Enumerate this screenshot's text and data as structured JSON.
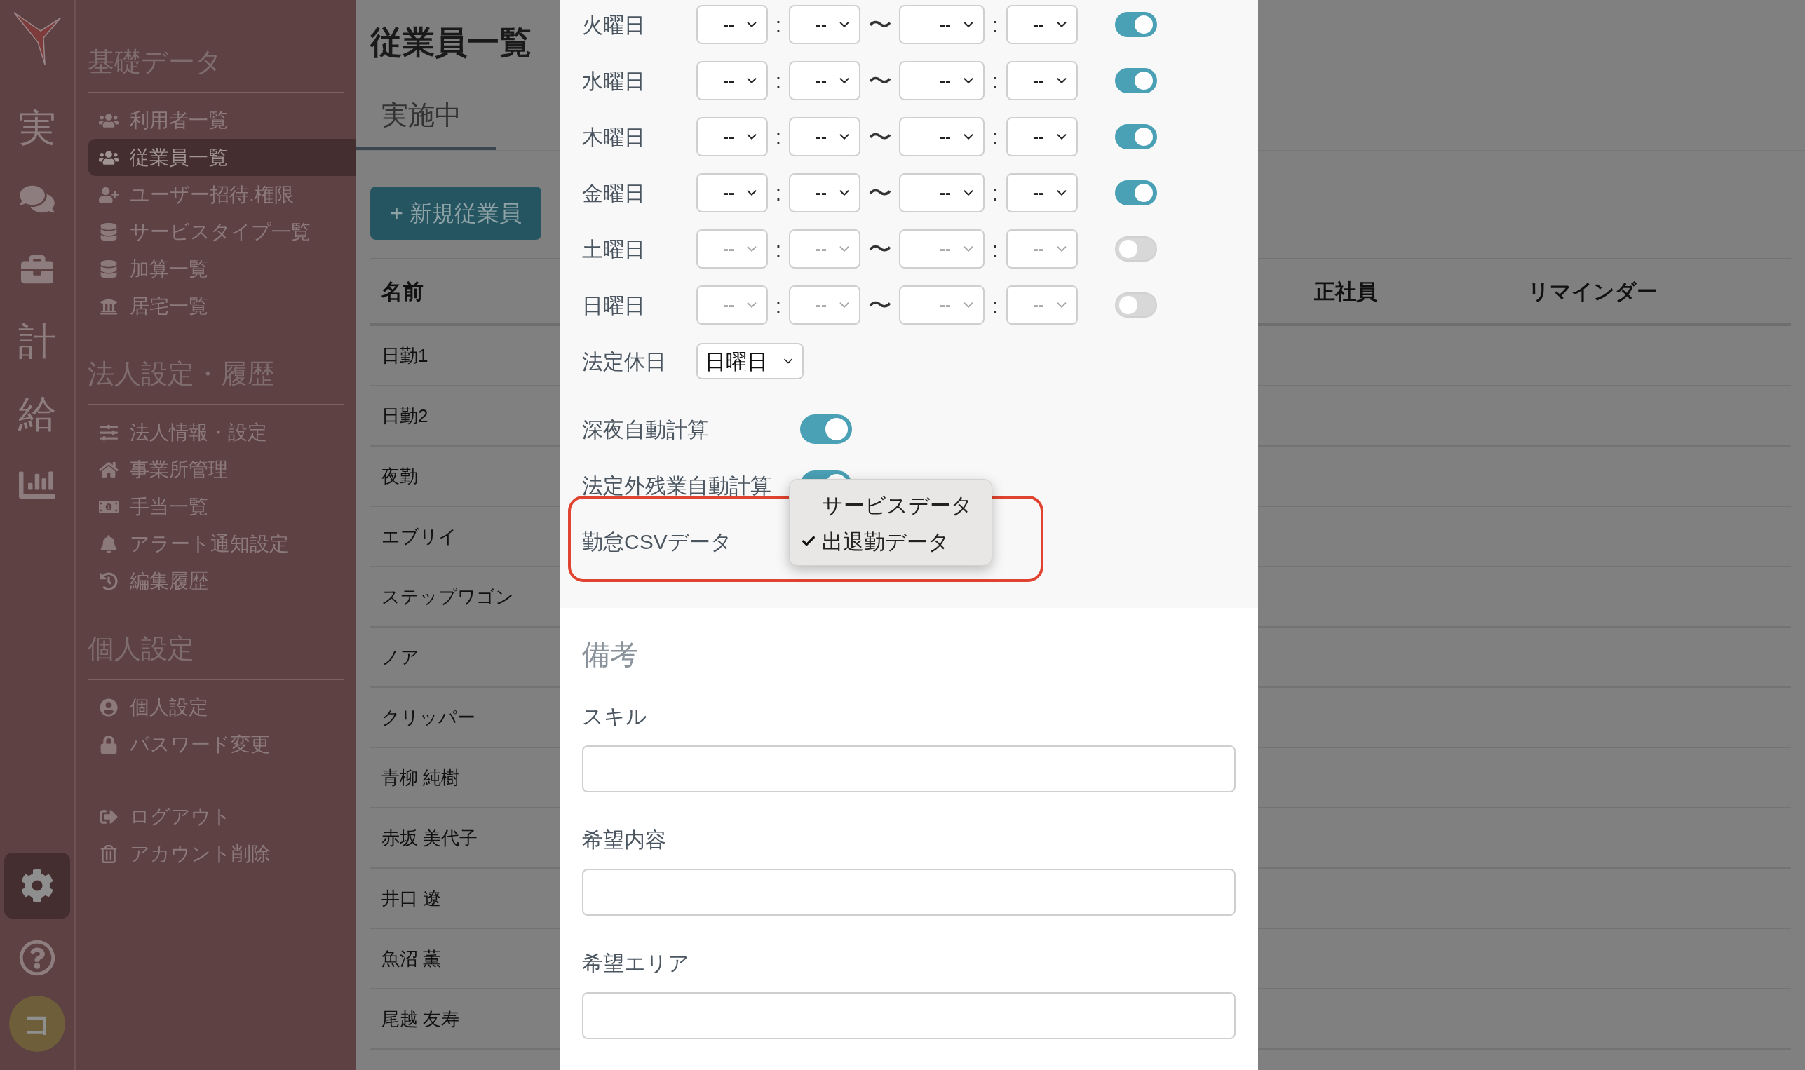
{
  "rail": {
    "items": [
      {
        "kind": "text",
        "label": "実"
      },
      {
        "kind": "chat"
      },
      {
        "kind": "briefcase"
      },
      {
        "kind": "text",
        "label": "計"
      },
      {
        "kind": "text",
        "label": "給"
      },
      {
        "kind": "chart"
      }
    ],
    "settings_selected": true,
    "avatar": "コ"
  },
  "sidebar": {
    "sections": [
      {
        "title": "基礎データ",
        "items": [
          {
            "kind": "users",
            "label": "利用者一覧",
            "selected": false
          },
          {
            "kind": "users",
            "label": "従業員一覧",
            "selected": true
          },
          {
            "kind": "user-plus",
            "label": "ユーザー招待.権限",
            "selected": false
          },
          {
            "kind": "database",
            "label": "サービスタイプ一覧",
            "selected": false
          },
          {
            "kind": "database",
            "label": "加算一覧",
            "selected": false
          },
          {
            "kind": "building",
            "label": "居宅一覧",
            "selected": false
          }
        ]
      },
      {
        "title": "法人設定・履歴",
        "items": [
          {
            "kind": "sliders",
            "label": "法人情報・設定",
            "selected": false
          },
          {
            "kind": "home",
            "label": "事業所管理",
            "selected": false
          },
          {
            "kind": "money",
            "label": "手当一覧",
            "selected": false
          },
          {
            "kind": "bell",
            "label": "アラート通知設定",
            "selected": false
          },
          {
            "kind": "history",
            "label": "編集履歴",
            "selected": false
          }
        ]
      },
      {
        "title": "個人設定",
        "items": [
          {
            "kind": "user",
            "label": "個人設定",
            "selected": false
          },
          {
            "kind": "lock",
            "label": "パスワード変更",
            "selected": false
          }
        ]
      },
      {
        "items": [
          {
            "kind": "logout",
            "label": "ログアウト",
            "selected": false
          },
          {
            "kind": "trash",
            "label": "アカウント削除",
            "selected": false
          }
        ]
      }
    ]
  },
  "main": {
    "title": "従業員一覧",
    "tabs": [
      {
        "label": "実施中",
        "selected": true
      }
    ],
    "new_button": "+ 新規従業員",
    "table": {
      "columns": [
        "名前",
        "正社員",
        "リマインダー"
      ],
      "rows": [
        "日勤1",
        "日勤2",
        "夜勤",
        "エブリイ",
        "ステップワゴン",
        "ノア",
        "クリッパー",
        "青柳 純樹",
        "赤坂 美代子",
        "井口 遼",
        "魚沼 薫",
        "尾越 友寿"
      ]
    }
  },
  "modal": {
    "schedule": [
      {
        "day": "火曜日",
        "times": [
          "--",
          "--",
          "--",
          "--"
        ],
        "separators": [
          ":",
          "〜",
          ":"
        ],
        "on": true
      },
      {
        "day": "水曜日",
        "times": [
          "--",
          "--",
          "--",
          "--"
        ],
        "separators": [
          ":",
          "〜",
          ":"
        ],
        "on": true
      },
      {
        "day": "木曜日",
        "times": [
          "--",
          "--",
          "--",
          "--"
        ],
        "separators": [
          ":",
          "〜",
          ":"
        ],
        "on": true
      },
      {
        "day": "金曜日",
        "times": [
          "--",
          "--",
          "--",
          "--"
        ],
        "separators": [
          ":",
          "〜",
          ":"
        ],
        "on": true
      },
      {
        "day": "土曜日",
        "times": [
          "--",
          "--",
          "--",
          "--"
        ],
        "separators": [
          ":",
          "〜",
          ":"
        ],
        "on": false
      },
      {
        "day": "日曜日",
        "times": [
          "--",
          "--",
          "--",
          "--"
        ],
        "separators": [
          ":",
          "〜",
          ":"
        ],
        "on": false
      }
    ],
    "legal_holiday": {
      "label": "法定休日",
      "value": "日曜日"
    },
    "toggles": [
      {
        "label": "深夜自動計算",
        "on": true
      },
      {
        "label": "法定外残業自動計算",
        "on": true
      }
    ],
    "csv": {
      "label": "勤怠CSVデータ",
      "options": [
        {
          "label": "サービスデータ",
          "selected": false
        },
        {
          "label": "出退勤データ",
          "selected": true
        }
      ]
    },
    "remarks": {
      "title": "備考",
      "fields": [
        {
          "label": "スキル"
        },
        {
          "label": "希望内容"
        },
        {
          "label": "希望エリア"
        }
      ]
    }
  }
}
